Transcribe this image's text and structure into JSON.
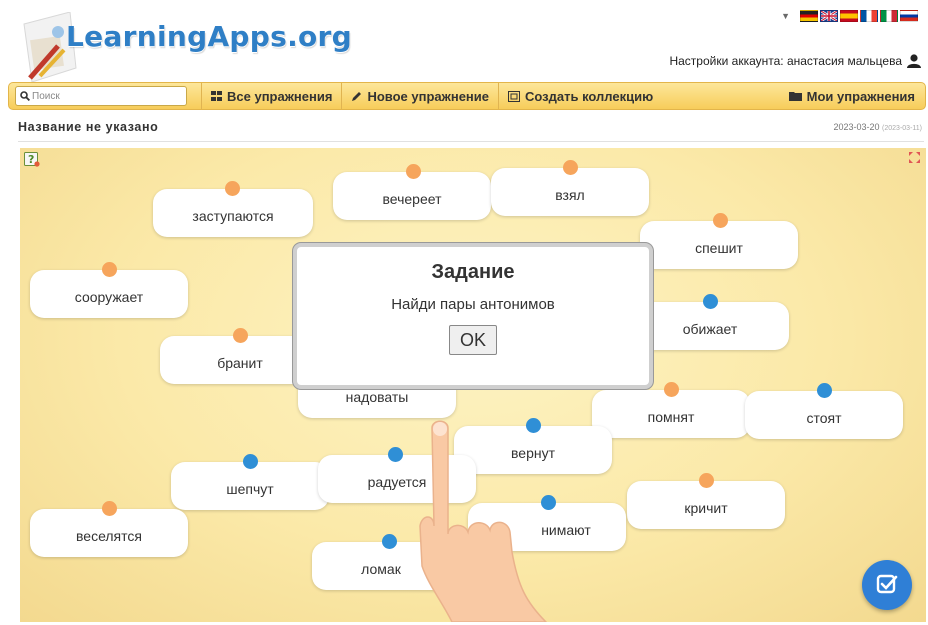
{
  "header": {
    "logo_text": "LearningApps.org",
    "account_label": "Настройки аккаунта: анастасия мальцева",
    "languages": [
      "de",
      "gb",
      "es",
      "fr",
      "it",
      "ru"
    ]
  },
  "toolbar": {
    "search_placeholder": "Поиск",
    "all_exercises": "Все упражнения",
    "new_exercise": "Новое упражнение",
    "create_collection": "Создать коллекцию",
    "my_exercises": "Мои упражнения"
  },
  "page": {
    "title": "Название не указано",
    "date": "2023-03-20",
    "date_small": "(2023-03-11)"
  },
  "cards": [
    {
      "label": "заступаются",
      "dot": "orange"
    },
    {
      "label": "вечереет",
      "dot": "orange"
    },
    {
      "label": "взял",
      "dot": "orange"
    },
    {
      "label": "спешит",
      "dot": "orange"
    },
    {
      "label": "сооружает",
      "dot": "orange"
    },
    {
      "label": "обижает",
      "dot": "blue"
    },
    {
      "label": "бранит",
      "dot": "orange"
    },
    {
      "label": "надоваты",
      "dot": "orange"
    },
    {
      "label": "помнят",
      "dot": "orange"
    },
    {
      "label": "стоят",
      "dot": "blue"
    },
    {
      "label": "вернут",
      "dot": "blue"
    },
    {
      "label": "шепчут",
      "dot": "blue"
    },
    {
      "label": "радуется",
      "dot": "blue"
    },
    {
      "label": "кричит",
      "dot": "orange"
    },
    {
      "label": "веселятся",
      "dot": "orange"
    },
    {
      "label": "нимают",
      "dot": "blue"
    },
    {
      "label": "ломак",
      "dot": "blue"
    }
  ],
  "dialog": {
    "title": "Задание",
    "text": "Найди пары антонимов",
    "ok_label": "OK"
  },
  "colors": {
    "accent_orange": "#f6a55c",
    "accent_blue": "#2f8fd6",
    "toolbar_yellow": "#f7cd5a",
    "logo_blue": "#2f7fc6"
  },
  "icons": {
    "search": "search-icon",
    "grid": "grid-icon",
    "pencil": "pencil-icon",
    "collection": "collection-icon",
    "folder": "folder-icon",
    "user": "user-icon",
    "help": "help-icon",
    "fullscreen": "fullscreen-icon",
    "check": "check-icon",
    "hand": "hand-pointer-icon"
  }
}
